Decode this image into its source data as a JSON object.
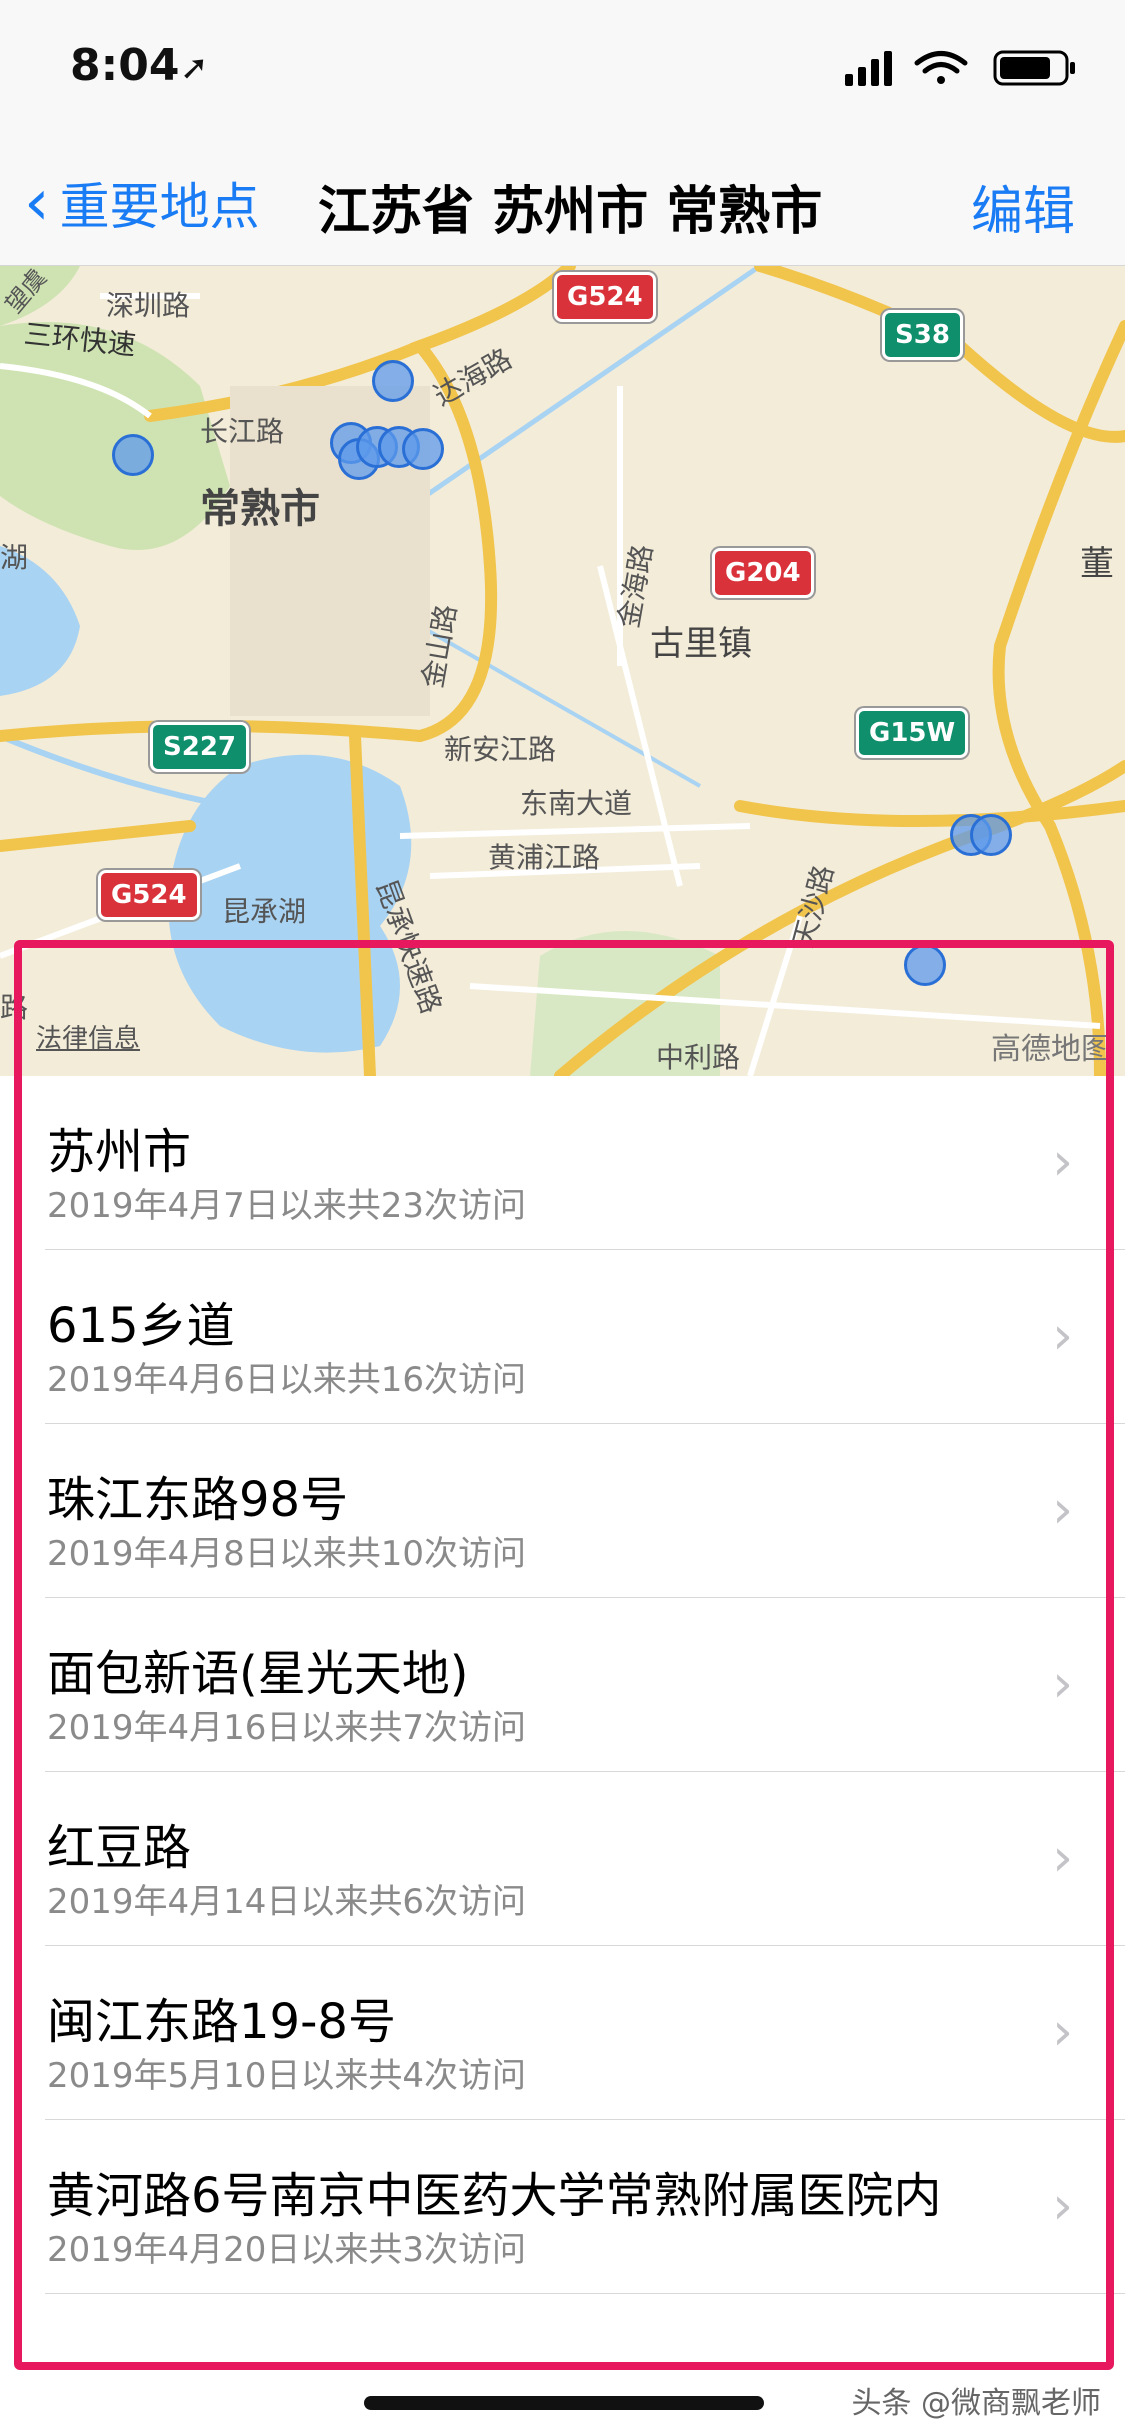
{
  "status_bar": {
    "time": "8:04"
  },
  "nav": {
    "back_label": "重要地点",
    "title": "江苏省 苏州市 常熟市",
    "edit_label": "编辑"
  },
  "map": {
    "labels": {
      "shenzhen_road": "深圳路",
      "sanhuan": "三环快速",
      "changjiang_road": "长江路",
      "dahai_road": "达海路",
      "city": "常熟市",
      "jinshan_road": "金山路",
      "jinhai_road": "金海路",
      "guli_town": "古里镇",
      "xinanjiang_road": "新安江路",
      "dongnan_avenue": "东南大道",
      "huangpujiang_road": "黄浦江路",
      "kuncheng_lake": "昆承湖",
      "kuncheng_express": "昆承快速路",
      "zhongli_road": "中利路",
      "dong": "董",
      "tiansha_road": "天沙路",
      "lu": "路",
      "wangyu": "望虞",
      "hu": "湖"
    },
    "shields": {
      "g524_top": "G524",
      "s38": "S38",
      "g204": "G204",
      "s227": "S227",
      "g15w": "G15W",
      "g524_left": "G524"
    },
    "legal_label": "法律信息",
    "attribution": "高德地图"
  },
  "places": [
    {
      "name": "苏州市",
      "visits": "2019年4月7日以来共23次访问"
    },
    {
      "name": "615乡道",
      "visits": "2019年4月6日以来共16次访问"
    },
    {
      "name": "珠江东路98号",
      "visits": "2019年4月8日以来共10次访问"
    },
    {
      "name": "面包新语(星光天地)",
      "visits": "2019年4月16日以来共7次访问"
    },
    {
      "name": "红豆路",
      "visits": "2019年4月14日以来共6次访问"
    },
    {
      "name": "闽江东路19-8号",
      "visits": "2019年5月10日以来共4次访问"
    },
    {
      "name": "黄河路6号南京中医药大学常熟附属医院内",
      "visits": "2019年4月20日以来共3次访问"
    }
  ],
  "watermark": "头条 @微商飘老师",
  "colors": {
    "accent": "#1a7cf5",
    "highlight": "#e8185f",
    "marker": "#5d99eb"
  }
}
